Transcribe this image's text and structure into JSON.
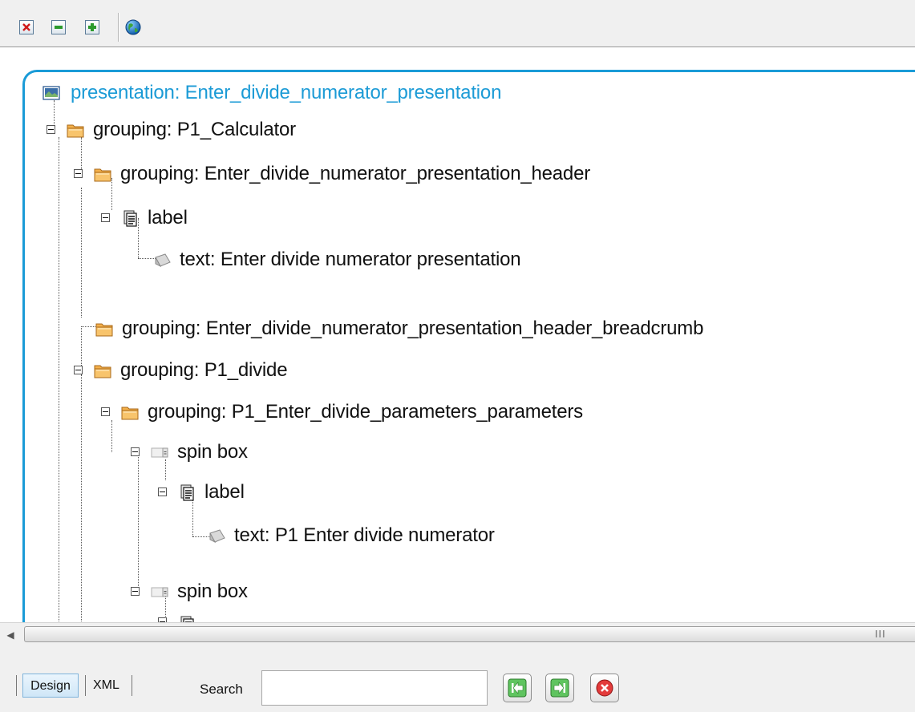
{
  "toolbar": {
    "icons": [
      "close-icon",
      "collapse-icon",
      "expand-icon",
      "globe-icon"
    ]
  },
  "tree": {
    "root": {
      "label": "presentation: Enter_divide_numerator_presentation",
      "icon": "presentation-icon"
    },
    "nodes": [
      {
        "label": "grouping: P1_Calculator",
        "icon": "folder-icon"
      },
      {
        "label": "grouping: Enter_divide_numerator_presentation_header",
        "icon": "folder-icon"
      },
      {
        "label": "label",
        "icon": "label-icon"
      },
      {
        "label": "text: Enter divide numerator presentation",
        "icon": "text-icon"
      },
      {
        "label": "grouping: Enter_divide_numerator_presentation_header_breadcrumb",
        "icon": "folder-icon"
      },
      {
        "label": "grouping: P1_divide",
        "icon": "folder-icon"
      },
      {
        "label": "grouping: P1_Enter_divide_parameters_parameters",
        "icon": "folder-icon"
      },
      {
        "label": "spin box",
        "icon": "spinbox-icon"
      },
      {
        "label": "label",
        "icon": "label-icon"
      },
      {
        "label": "text: P1 Enter divide numerator",
        "icon": "text-icon"
      },
      {
        "label": "spin box",
        "icon": "spinbox-icon"
      }
    ]
  },
  "scrollbar": {
    "grip": "III"
  },
  "bottom": {
    "tabs": [
      {
        "label": "Design",
        "active": true
      },
      {
        "label": "XML",
        "active": false
      }
    ],
    "search": {
      "label": "Search",
      "value": "",
      "placeholder": ""
    },
    "buttons": [
      "previous-icon",
      "next-icon",
      "clear-icon"
    ]
  },
  "colors": {
    "accent": "#1a9bd7",
    "root_text": "#1c9bd6",
    "folder": "#f0a030"
  }
}
